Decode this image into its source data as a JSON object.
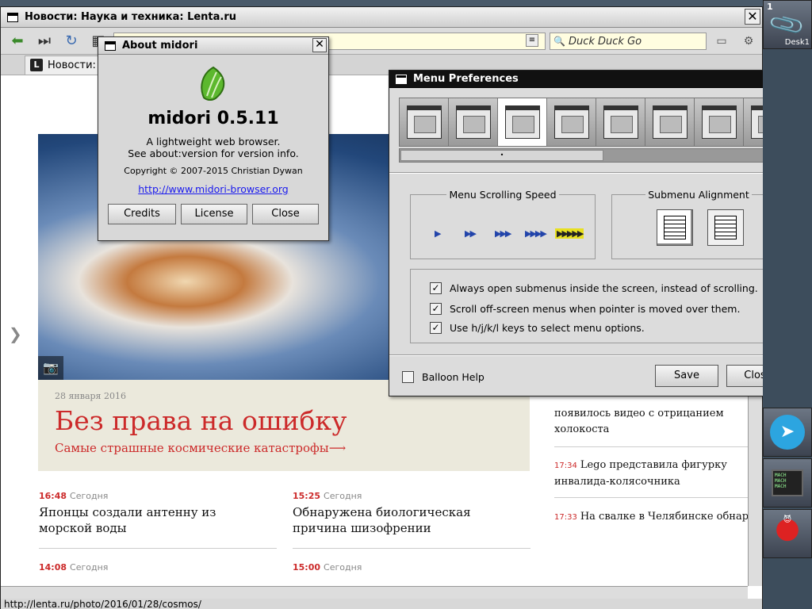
{
  "browser": {
    "title": "Новости: Наука и техника: Lenta.ru",
    "close_glyph": "✕",
    "search": {
      "placeholder": "Duck Duck Go"
    },
    "tab": {
      "favicon": "L",
      "label": "Новости: Н"
    },
    "status_url": "http://lenta.ru/photo/2016/01/28/cosmos/",
    "content": {
      "caption": {
        "date": "28 января 2016",
        "title": "Без права на ошибку",
        "subtitle": "Самые страшные космические катастрофы⟶"
      },
      "news": [
        {
          "time": "16:48",
          "day": "Сегодня",
          "headline": "Японцы создали антенну из морской воды"
        },
        {
          "time": "15:25",
          "day": "Сегодня",
          "headline": "Обнаружена биологическая причина шизофрении"
        },
        {
          "time": "14:08",
          "day": "Сегодня",
          "headline": ""
        },
        {
          "time": "15:00",
          "day": "Сегодня",
          "headline": ""
        }
      ],
      "right_news": [
        {
          "time": "",
          "headline": "появилось видео с отрицанием холокоста"
        },
        {
          "time": "17:34",
          "headline": "Lego представила фигурку инвалида-колясочника"
        },
        {
          "time": "17:33",
          "headline": "На свалке в Челябинске обнаружили деревню мигрантов"
        }
      ]
    },
    "icons": {
      "back": "back-arrow-icon",
      "forward": "forward-icon",
      "reload": "reload-icon",
      "camera": "camera-icon",
      "search": "magnifier-icon"
    },
    "colors": {
      "accent": "#cc2a2a",
      "caption_bg": "#ebe9dc",
      "url_bg": "#fffde0"
    }
  },
  "about": {
    "title": "About midori",
    "app_name": "midori 0.5.11",
    "desc_line1": "A lightweight web browser.",
    "desc_line2": "See about:version for version info.",
    "copyright": "Copyright © 2007-2015 Christian Dywan",
    "url": "http://www.midori-browser.org",
    "buttons": {
      "credits": "Credits",
      "license": "License",
      "close": "Close"
    }
  },
  "menu_prefs": {
    "title": "Menu Preferences",
    "scrolling_speed_label": "Menu Scrolling Speed",
    "submenu_alignment_label": "Submenu Alignment",
    "options": [
      {
        "label": "Always open submenus inside the screen, instead of scrolling.",
        "checked": true
      },
      {
        "label": "Scroll off-screen menus when pointer is moved over them.",
        "checked": true
      },
      {
        "label": "Use h/j/k/l keys to select menu options.",
        "checked": true
      }
    ],
    "balloon_help": "Balloon Help",
    "save": "Save",
    "close": "Close",
    "check_glyph": "✓"
  },
  "dock": {
    "desk_number": "1",
    "desk_label": "Desk1",
    "terminal_text": "MACH\nMACH\nMACH"
  }
}
